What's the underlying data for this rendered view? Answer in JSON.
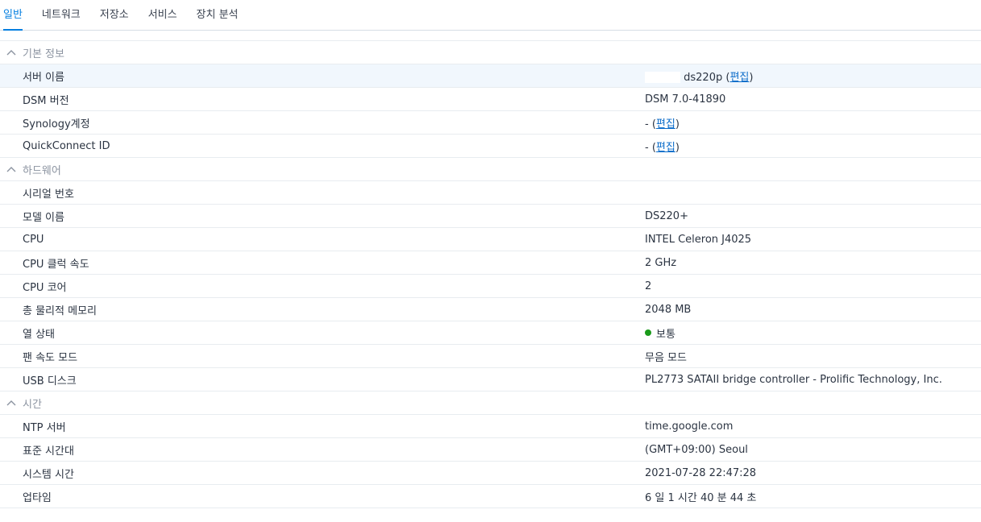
{
  "tabs": [
    {
      "label": "일반",
      "active": true
    },
    {
      "label": "네트워크"
    },
    {
      "label": "저장소"
    },
    {
      "label": "서비스"
    },
    {
      "label": "장치 분석"
    }
  ],
  "sections": {
    "basic": {
      "title": "기본 정보",
      "server_name": {
        "label": "서버 이름",
        "value": "ds220p",
        "edit": "편집"
      },
      "dsm_version": {
        "label": "DSM 버전",
        "value": "DSM 7.0-41890"
      },
      "synology_account": {
        "label": "Synology계정",
        "value": "-",
        "edit": "편집"
      },
      "quickconnect_id": {
        "label": "QuickConnect ID",
        "value": "-",
        "edit": "편집"
      }
    },
    "hardware": {
      "title": "하드웨어",
      "serial": {
        "label": "시리얼 번호",
        "value": ""
      },
      "model": {
        "label": "모델 이름",
        "value": "DS220+"
      },
      "cpu": {
        "label": "CPU",
        "value": "INTEL Celeron J4025"
      },
      "cpu_clock": {
        "label": "CPU 클럭 속도",
        "value": "2 GHz"
      },
      "cpu_cores": {
        "label": "CPU 코어",
        "value": "2"
      },
      "memory": {
        "label": "총 물리적 메모리",
        "value": "2048 MB"
      },
      "thermal": {
        "label": "열 상태",
        "value": "보통",
        "color": "#1a8a1a"
      },
      "fan_mode": {
        "label": "팬 속도 모드",
        "value": "무음 모드"
      },
      "usb_disk": {
        "label": "USB 디스크",
        "value": "PL2773 SATAII bridge controller - Prolific Technology, Inc."
      }
    },
    "time": {
      "title": "시간",
      "ntp": {
        "label": "NTP 서버",
        "value": "time.google.com"
      },
      "timezone": {
        "label": "표준 시간대",
        "value": "(GMT+09:00) Seoul"
      },
      "system_time": {
        "label": "시스템 시간",
        "value": "2021-07-28 22:47:28"
      },
      "uptime": {
        "label": "업타임",
        "value": "6 일 1 시간 40 분 44 초"
      }
    }
  },
  "colors": {
    "accent": "#057fe0",
    "link": "#0a6bc9",
    "status_ok": "#1a8a1a"
  }
}
